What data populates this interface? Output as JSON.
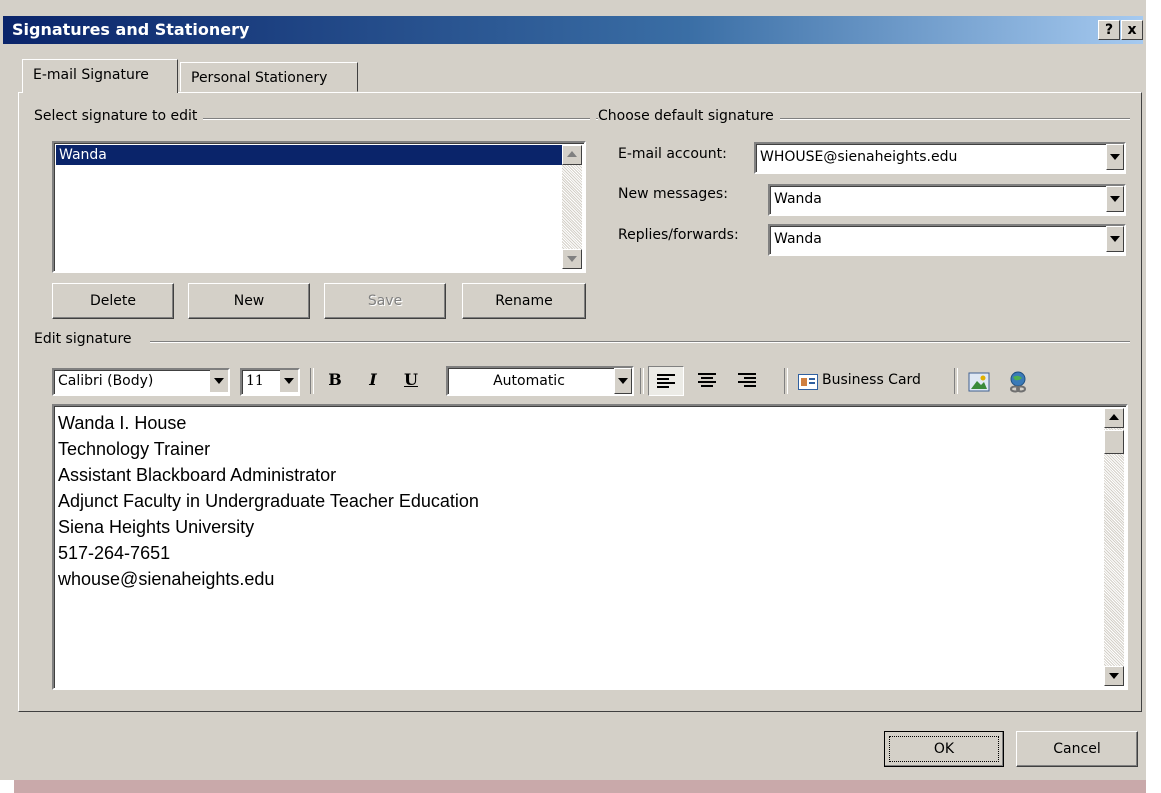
{
  "window": {
    "title": "Signatures and Stationery",
    "help_label": "?",
    "close_label": "x"
  },
  "tabs": [
    {
      "label": "E-mail Signature",
      "selected": true
    },
    {
      "label": "Personal Stationery",
      "selected": false
    }
  ],
  "select_group": {
    "label": "Select signature to edit",
    "signatures": [
      "Wanda"
    ],
    "selected": "Wanda",
    "buttons": {
      "delete": "Delete",
      "new": "New",
      "save": "Save",
      "rename": "Rename"
    }
  },
  "default_group": {
    "label": "Choose default signature",
    "email_account_label": "E-mail account:",
    "email_account_value": "WHOUSE@sienaheights.edu",
    "new_messages_label": "New messages:",
    "new_messages_value": "Wanda",
    "replies_label": "Replies/forwards:",
    "replies_value": "Wanda"
  },
  "edit_group": {
    "label": "Edit signature",
    "font_name": "Calibri (Body)",
    "font_size": "11",
    "bold_label": "B",
    "italic_label": "I",
    "underline_label": "U",
    "color_value": "Automatic",
    "business_card_label": "Business Card",
    "signature_lines": [
      "Wanda I. House",
      "Technology Trainer",
      "Assistant Blackboard Administrator",
      "Adjunct Faculty in Undergraduate Teacher Education",
      "Siena Heights University",
      "517-264-7651",
      "whouse@sienaheights.edu"
    ]
  },
  "footer": {
    "ok_label": "OK",
    "cancel_label": "Cancel"
  },
  "colors": {
    "titlebar_start": "#0a246a",
    "titlebar_end": "#a6caf0",
    "selection": "#0a246a",
    "dialog_bg": "#d4d0c8"
  }
}
